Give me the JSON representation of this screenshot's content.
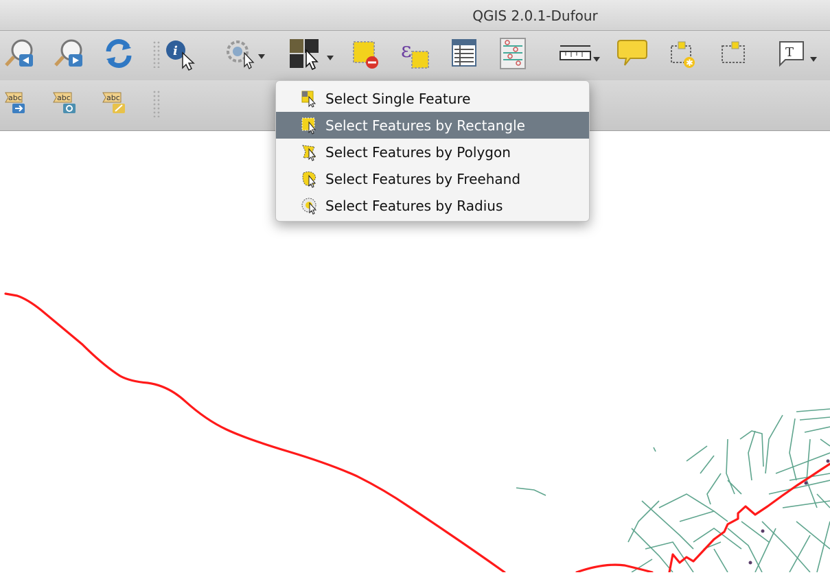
{
  "window": {
    "title": "QGIS 2.0.1-Dufour"
  },
  "menu": {
    "items": [
      {
        "label": "Select Single Feature",
        "icon": "select-single-feature-icon"
      },
      {
        "label": "Select Features by Rectangle",
        "icon": "select-rectangle-icon",
        "active": true
      },
      {
        "label": "Select Features by Polygon",
        "icon": "select-polygon-icon"
      },
      {
        "label": "Select Features by Freehand",
        "icon": "select-freehand-icon"
      },
      {
        "label": "Select Features by Radius",
        "icon": "select-radius-icon"
      }
    ]
  },
  "toolbar2": {
    "labels": [
      "abc",
      "abc",
      "abc"
    ]
  },
  "colors": {
    "route_line": "#ff1a1a",
    "streets": "#5fa58e",
    "menu_highlight": "#6f7b86"
  }
}
